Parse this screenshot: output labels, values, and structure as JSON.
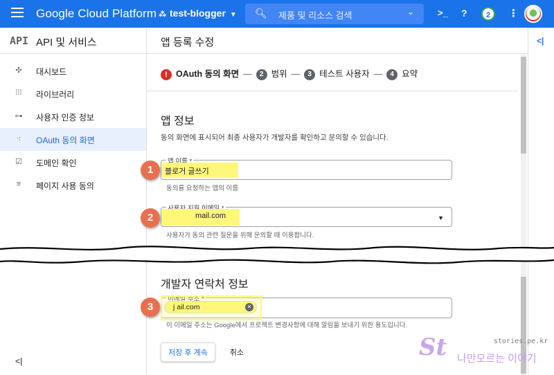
{
  "topbar": {
    "brand": "Google Cloud Platform",
    "project": "test-blogger",
    "search_placeholder": "제품 및 리소스 검색",
    "notifications": "2"
  },
  "sidebar": {
    "api_logo": "API",
    "title": "API 및 서비스",
    "items": [
      {
        "label": "대시보드",
        "icon": "dashboard-icon"
      },
      {
        "label": "라이브러리",
        "icon": "library-icon"
      },
      {
        "label": "사용자 인증 정보",
        "icon": "key-icon"
      },
      {
        "label": "OAuth 동의 화면",
        "icon": "consent-icon",
        "active": true
      },
      {
        "label": "도메인 확인",
        "icon": "domain-check-icon"
      },
      {
        "label": "페이지 사용 동의",
        "icon": "settings-list-icon"
      }
    ]
  },
  "main": {
    "page_title": "앱 등록 수정",
    "steps": {
      "step1": "OAuth 동의 화면",
      "step2_num": "2",
      "step2": "범위",
      "step3_num": "3",
      "step3": "테스트 사용자",
      "step4_num": "4",
      "step4": "요약"
    },
    "app_info": {
      "heading": "앱 정보",
      "description": "동의 화면에 표시되어 최종 사용자가 개발자를 확인하고 문의할 수 있습니다.",
      "app_name_label": "앱 이름 *",
      "app_name_value": "블로거 글쓰기",
      "app_name_hint": "동의를 요청하는 앱의 이름",
      "support_email_label": "사용자 지원 이메일 *",
      "support_email_value": "mail.com",
      "support_email_hint": "사용자가 동의 관련 질문을 위해 문의할 때 이용합니다."
    },
    "dev_contact": {
      "heading": "개발자 연락처 정보",
      "email_label": "이메일 주소 *",
      "email_chip": "j          ail.com",
      "email_hint": "이 이메일 주소는 Google에서 프로젝트 변경사항에 대해 알림을 보내기 위한 용도입니다."
    },
    "buttons": {
      "save": "저장 후 계속",
      "cancel": "취소"
    }
  },
  "annotations": {
    "badge1": "1",
    "badge2": "2",
    "badge3": "3"
  },
  "watermark": {
    "domain": "stories.pe.kr",
    "logo": "St",
    "text": "나만모르는 이야기"
  },
  "colors": {
    "primary": "#1a73e8",
    "highlight": "#fff77a",
    "badge": "#e9704f",
    "error": "#d93025"
  }
}
